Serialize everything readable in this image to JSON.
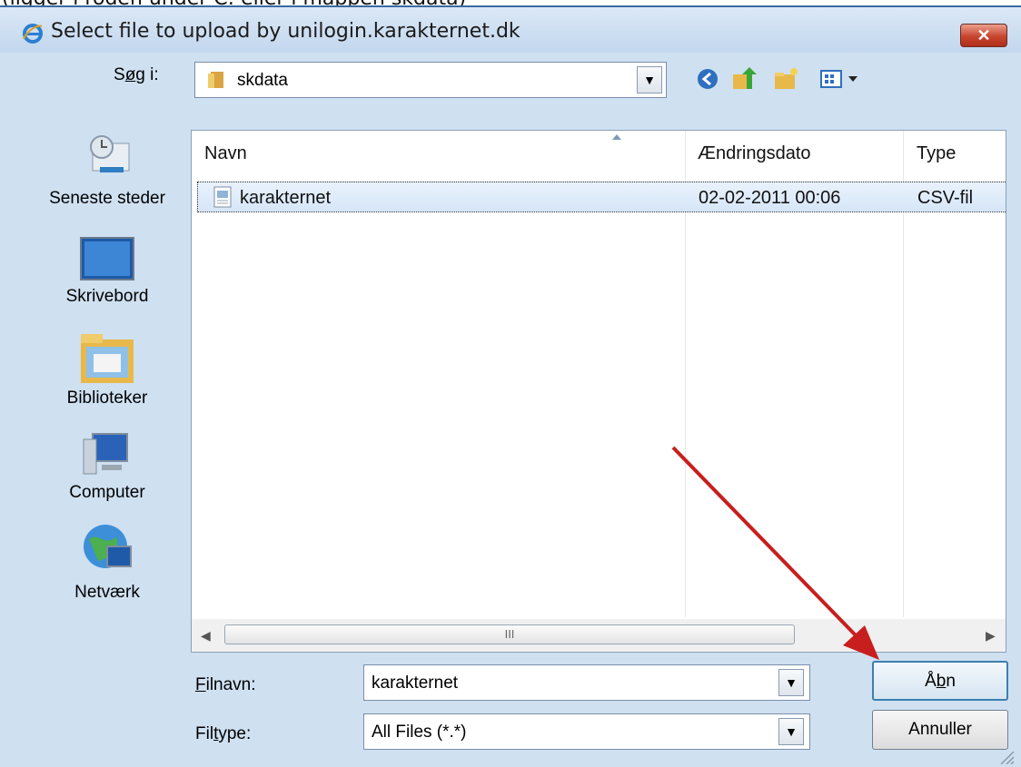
{
  "window": {
    "title": "Select file to upload by unilogin.karakternet.dk",
    "close_label": "✕"
  },
  "top_cut_text": "(ligger i roden under C: eller i mappen skdata)",
  "lookin": {
    "label_prefix": "S",
    "label_underlined": "ø",
    "label_suffix": "g i:",
    "value": "skdata"
  },
  "places": [
    {
      "label": "Seneste steder",
      "icon": "recent-places-icon"
    },
    {
      "label": "Skrivebord",
      "icon": "desktop-icon"
    },
    {
      "label": "Biblioteker",
      "icon": "libraries-icon"
    },
    {
      "label": "Computer",
      "icon": "computer-icon"
    },
    {
      "label": "Netværk",
      "icon": "network-icon"
    }
  ],
  "columns": [
    "Navn",
    "Ændringsdato",
    "Type"
  ],
  "files": [
    {
      "name": "karakternet",
      "date": "02-02-2011 00:06",
      "type": "CSV-fil"
    }
  ],
  "scroll_thumb": "III",
  "filename": {
    "label_underlined": "F",
    "label_rest": "ilnavn:",
    "value": "karakternet"
  },
  "filetype": {
    "label_prefix": "Fil",
    "label_underlined": "t",
    "label_suffix": "ype:",
    "value": "All Files (*.*)"
  },
  "buttons": {
    "open_prefix": "Å",
    "open_underlined": "b",
    "open_suffix": "n",
    "cancel": "Annuller"
  },
  "colors": {
    "dialog_bg": "#cfe0f1",
    "arrow": "#c81e1e",
    "close_button": "#c8452f",
    "selection": "#d6e6f8"
  }
}
